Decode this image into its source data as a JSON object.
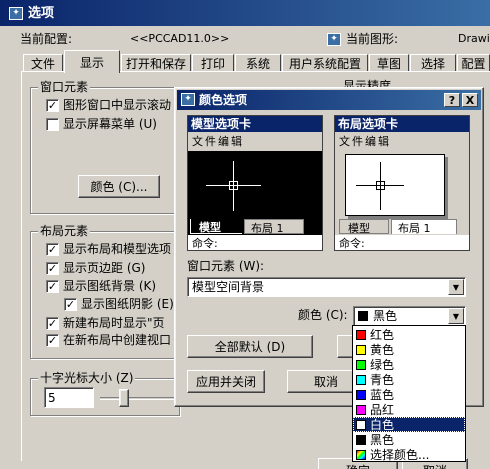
{
  "options_window": {
    "title": "选项",
    "current_config_label": "当前配置:",
    "current_config_value": "<<PCCAD11.0>>",
    "current_drawing_label": "当前图形:",
    "current_drawing_value": "Drawi",
    "tabs": [
      "文件",
      "显示",
      "打开和保存",
      "打印",
      "系统",
      "用户系统配置",
      "草图",
      "选择",
      "配置"
    ],
    "active_tab": "显示",
    "window_elements": {
      "title": "窗口元素",
      "items": [
        {
          "label": "图形窗口中显示滚动",
          "checked": true
        },
        {
          "label": "显示屏幕菜单 (U)",
          "checked": false
        }
      ],
      "colors_button": "颜色 (C)..."
    },
    "display_precision_partial": "显示精度",
    "layout_elements": {
      "title": "布局元素",
      "items": [
        {
          "label": "显示布局和模型选项",
          "checked": true
        },
        {
          "label": "显示页边距 (G)",
          "checked": true
        },
        {
          "label": "显示图纸背景 (K)",
          "checked": true
        },
        {
          "label": "显示图纸阴影 (E)",
          "checked": true
        },
        {
          "label": "新建布局时显示\"页",
          "checked": true
        },
        {
          "label": "在新布局中创建视口",
          "checked": true
        }
      ]
    },
    "crosshair": {
      "title": "十字光标大小 (Z)",
      "value": "5"
    },
    "ok_button": "确定",
    "cancel_button": "取消"
  },
  "color_dialog": {
    "title": "颜色选项",
    "help_button": "?",
    "close_button": "X",
    "model_preview": {
      "header": "模型选项卡",
      "menu": "文件编辑",
      "tab_model": "模型",
      "tab_layout": "布局 1",
      "command": "命令:"
    },
    "layout_preview": {
      "header": "布局选项卡",
      "menu": "文件编辑",
      "tab_model": "模型",
      "tab_layout": "布局 1",
      "command": "命令:"
    },
    "window_element_label": "窗口元素 (W):",
    "window_element_value": "模型空间背景",
    "color_label": "颜色 (C):",
    "color_value": "黑色",
    "color_options": [
      {
        "label": "红色",
        "color": "#ff0000"
      },
      {
        "label": "黄色",
        "color": "#ffff00"
      },
      {
        "label": "绿色",
        "color": "#00ff00"
      },
      {
        "label": "青色",
        "color": "#00ffff"
      },
      {
        "label": "蓝色",
        "color": "#0000ff"
      },
      {
        "label": "品红",
        "color": "#ff00ff"
      },
      {
        "label": "白色",
        "color": "#ffffff"
      },
      {
        "label": "黑色",
        "color": "#000000"
      },
      {
        "label": "选择颜色...",
        "color": "multicolor"
      }
    ],
    "highlighted_option": "白色",
    "restore_all_button": "全部默认 (D)",
    "apply_close_button": "应用并关闭",
    "cancel_button": "取消"
  }
}
